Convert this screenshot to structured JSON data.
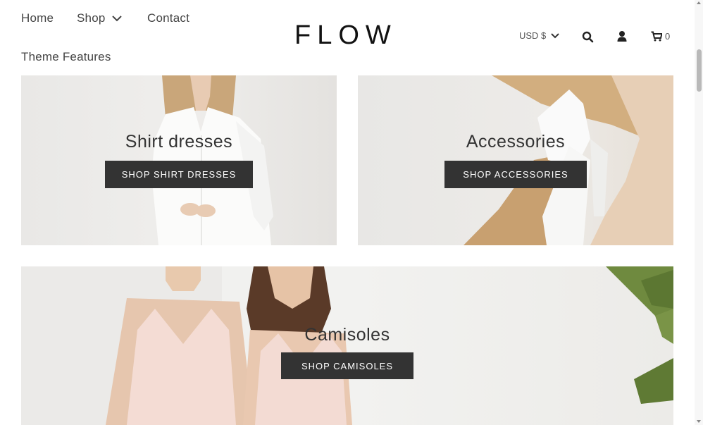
{
  "nav": {
    "home": "Home",
    "shop": "Shop",
    "contact": "Contact",
    "theme_features": "Theme Features"
  },
  "logo": "FLOW",
  "currency": "USD $",
  "cart_count": "0",
  "icons": {
    "shop_dropdown": "chevron-down-icon",
    "currency_dropdown": "chevron-down-icon",
    "search": "search-icon",
    "account": "user-icon",
    "cart": "cart-icon"
  },
  "tiles": [
    {
      "title": "Shirt dresses",
      "button": "SHOP SHIRT DRESSES"
    },
    {
      "title": "Accessories",
      "button": "SHOP ACCESSORIES"
    },
    {
      "title": "Camisoles",
      "button": "SHOP CAMISOLES"
    }
  ],
  "colors": {
    "button_bg": "#333333",
    "button_text": "#ffffff",
    "text": "#444444"
  }
}
